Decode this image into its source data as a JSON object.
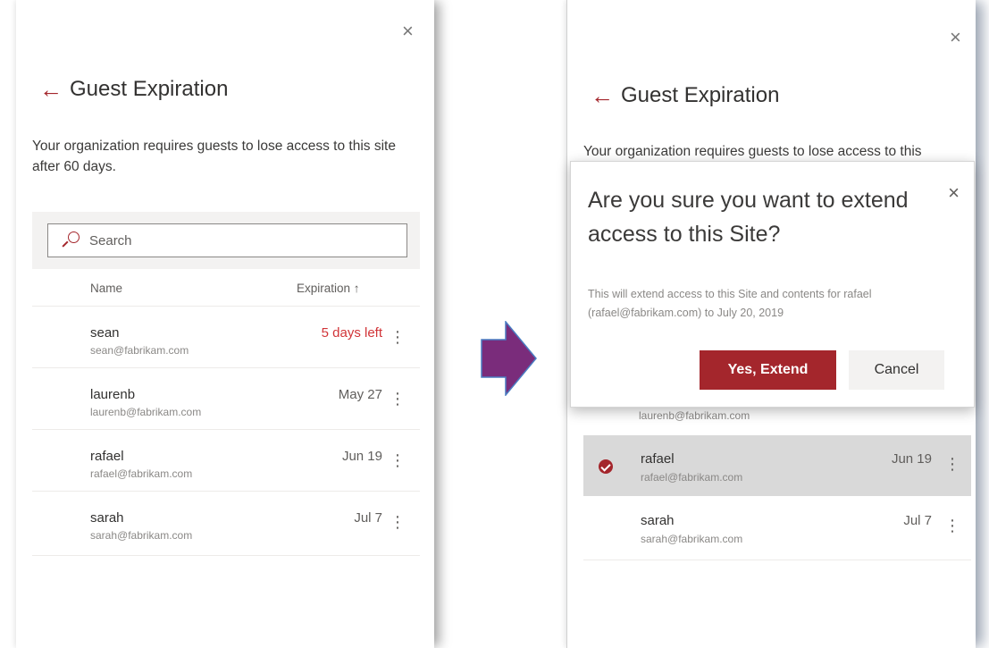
{
  "panel_left": {
    "close": "×",
    "back": "←",
    "title": "Guest Expiration",
    "description": "Your organization requires guests to lose access to this site after 60 days.",
    "search_placeholder": "Search",
    "columns": {
      "name": "Name",
      "expiration": "Expiration ↑"
    },
    "rows": [
      {
        "name": "sean",
        "email": "sean@fabrikam.com",
        "expiration": "5 days left",
        "warning": true
      },
      {
        "name": "laurenb",
        "email": "laurenb@fabrikam.com",
        "expiration": "May 27"
      },
      {
        "name": "rafael",
        "email": "rafael@fabrikam.com",
        "expiration": "Jun 19"
      },
      {
        "name": "sarah",
        "email": "sarah@fabrikam.com",
        "expiration": "Jul 7"
      }
    ],
    "more": "⋮"
  },
  "panel_right": {
    "close": "×",
    "back": "←",
    "title": "Guest Expiration",
    "description": "Your organization requires guests to lose access to this",
    "rows": [
      {
        "email": "laurenb@fabrikam.com"
      },
      {
        "name": "rafael",
        "email": "rafael@fabrikam.com",
        "expiration": "Jun 19",
        "selected": true
      },
      {
        "name": "sarah",
        "email": "sarah@fabrikam.com",
        "expiration": "Jul 7"
      }
    ],
    "more": "⋮"
  },
  "dialog": {
    "title": "Are you sure you want to extend access to this Site?",
    "body": "This will extend access to this Site and contents for rafael (rafael@fabrikam.com) to July 20, 2019",
    "close": "×",
    "confirm_label": "Yes, Extend",
    "cancel_label": "Cancel"
  },
  "colors": {
    "accent": "#a4262c",
    "warning": "#d13438",
    "arrow": "#7a2c7b",
    "arrow_border": "#4a7cc2"
  }
}
